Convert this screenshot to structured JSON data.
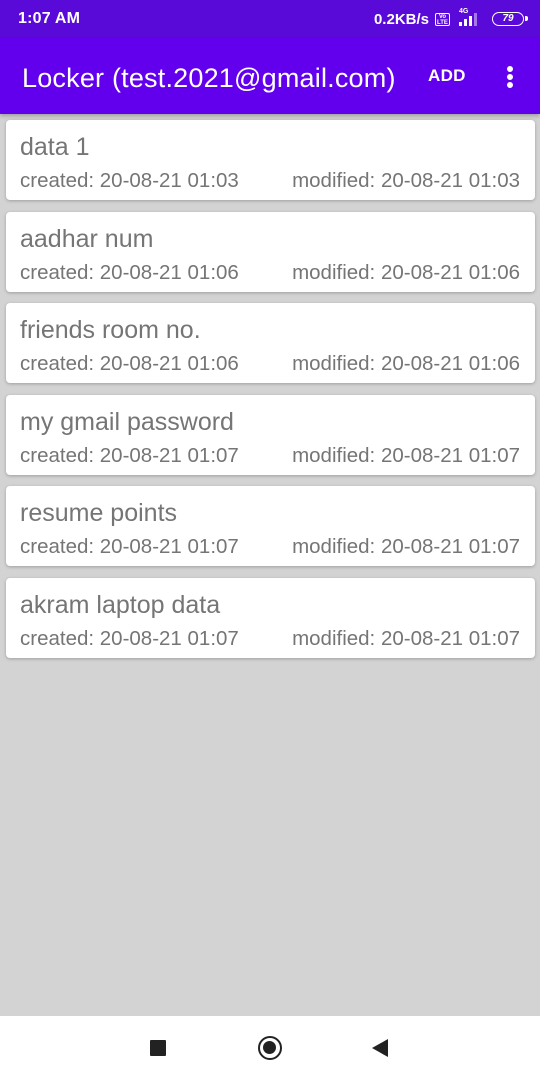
{
  "status_bar": {
    "time": "1:07 AM",
    "net_speed": "0.2KB/s",
    "volte_icon": "volte-icon",
    "network_type": "4G",
    "signal_icon": "signal-icon",
    "battery_level": "79",
    "battery_icon": "battery-icon"
  },
  "app_bar": {
    "title": "Locker (test.2021@gmail.com)",
    "add_label": "ADD",
    "overflow_icon": "more-vert-icon",
    "colors": {
      "app_bar": "#6200ee",
      "status_bar": "#5a0ad8"
    }
  },
  "notes": [
    {
      "title": "data 1",
      "created": "created: 20-08-21 01:03",
      "modified": "modified: 20-08-21 01:03"
    },
    {
      "title": "aadhar num",
      "created": "created: 20-08-21 01:06",
      "modified": "modified: 20-08-21 01:06"
    },
    {
      "title": "friends room no.",
      "created": "created: 20-08-21 01:06",
      "modified": "modified: 20-08-21 01:06"
    },
    {
      "title": "my gmail password",
      "created": "created: 20-08-21 01:07",
      "modified": "modified: 20-08-21 01:07"
    },
    {
      "title": "resume points",
      "created": "created: 20-08-21 01:07",
      "modified": "modified: 20-08-21 01:07"
    },
    {
      "title": "akram laptop data",
      "created": "created: 20-08-21 01:07",
      "modified": "modified: 20-08-21 01:07"
    }
  ],
  "nav_bar": {
    "recent_icon": "square-icon",
    "home_icon": "circle-icon",
    "back_icon": "triangle-back-icon"
  }
}
